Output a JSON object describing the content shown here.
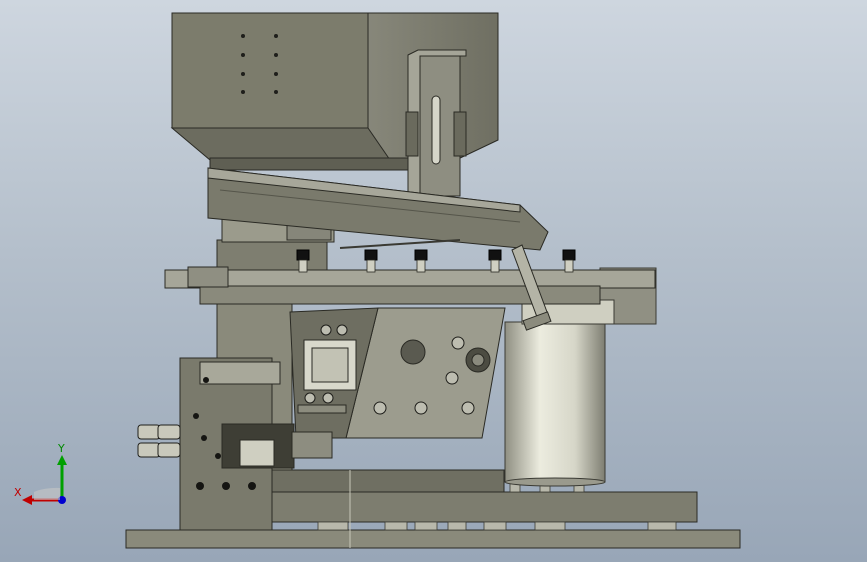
{
  "viewport": {
    "background_top": "#ced6df",
    "background_bottom": "#98a6b7"
  },
  "model": {
    "description_icon": "feeder-assembly-model",
    "body_color": "#7c7c6c",
    "dark_color": "#4e4e44",
    "light_color": "#a9a99a",
    "drum_color": "#d9d9cc"
  },
  "triad": {
    "x_label": "X",
    "y_label": "Y",
    "x_color": "#c00000",
    "y_color": "#00a000",
    "z_color": "#0000d0"
  }
}
